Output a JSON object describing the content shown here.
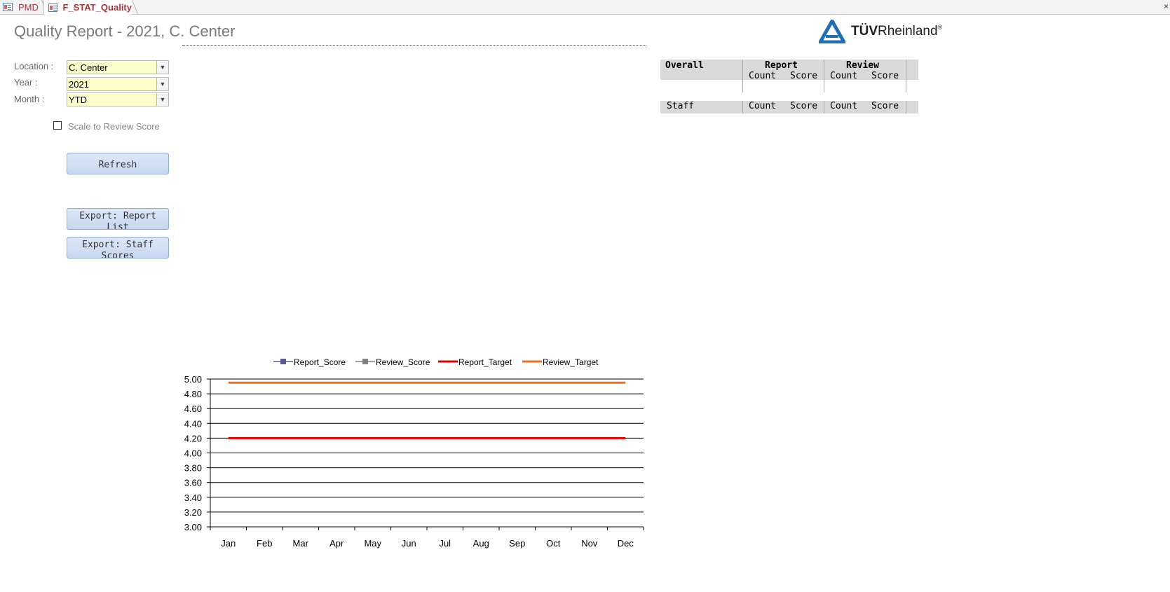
{
  "tabs": [
    {
      "label": "PMD",
      "active": false
    },
    {
      "label": "F_STAT_Quality",
      "active": true
    }
  ],
  "tabbar": {
    "close_glyph": "×"
  },
  "page": {
    "title": "Quality Report - 2021, C. Center"
  },
  "logo": {
    "text_bold": "TÜV",
    "text_rest": "Rheinland",
    "reg": "®"
  },
  "filters": {
    "location": {
      "label": "Location :",
      "value": "C. Center"
    },
    "year": {
      "label": "Year :",
      "value": "2021"
    },
    "month": {
      "label": "Month :",
      "value": "YTD"
    }
  },
  "options": {
    "scale_to_review": {
      "label": "Scale to Review Score",
      "checked": false
    }
  },
  "buttons": {
    "refresh": "Refresh",
    "export_report": "Export: Report List",
    "export_staff": "Export: Staff Scores"
  },
  "summary": {
    "overall": {
      "title": "Overall",
      "report_header": "Report",
      "review_header": "Review",
      "count": "Count",
      "score": "Score"
    },
    "staff": {
      "title": "Staff",
      "count": "Count",
      "score": "Score"
    }
  },
  "colors": {
    "report_target": "#e00000",
    "review_target": "#f07020",
    "report_score": "#5a5a9a",
    "review_score": "#808080",
    "accent_tab": "#a4373a",
    "combo_fill": "#ffffcc",
    "logo_blue": "#1f6fb4"
  },
  "icons": {
    "tab": "form-icon",
    "combo_arrow": "chevron-down-icon",
    "logo": "tuv-triangle-icon",
    "close": "close-icon"
  },
  "chart_data": {
    "type": "line",
    "categories": [
      "Jan",
      "Feb",
      "Mar",
      "Apr",
      "May",
      "Jun",
      "Jul",
      "Aug",
      "Sep",
      "Oct",
      "Nov",
      "Dec"
    ],
    "series": [
      {
        "name": "Report_Score",
        "values": [],
        "color": "#5a5a9a",
        "marker": "square"
      },
      {
        "name": "Review_Score",
        "values": [],
        "color": "#808080",
        "marker": "square"
      },
      {
        "name": "Report_Target",
        "values": [
          4.2,
          4.2,
          4.2,
          4.2,
          4.2,
          4.2,
          4.2,
          4.2,
          4.2,
          4.2,
          4.2,
          4.2
        ],
        "color": "#e00000"
      },
      {
        "name": "Review_Target",
        "values": [
          4.95,
          4.95,
          4.95,
          4.95,
          4.95,
          4.95,
          4.95,
          4.95,
          4.95,
          4.95,
          4.95,
          4.95
        ],
        "color": "#f07020"
      }
    ],
    "ylim": [
      3.0,
      5.0
    ],
    "yticks": [
      "3.00",
      "3.20",
      "3.40",
      "3.60",
      "3.80",
      "4.00",
      "4.20",
      "4.40",
      "4.60",
      "4.80",
      "5.00"
    ],
    "grid": true,
    "legend": "top"
  }
}
